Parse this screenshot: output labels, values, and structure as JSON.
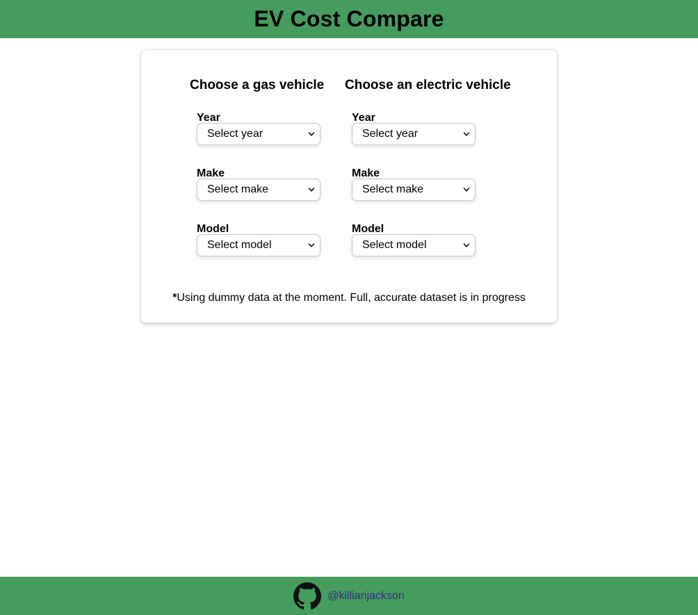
{
  "header": {
    "title": "EV Cost Compare"
  },
  "gas": {
    "title": "Choose a gas vehicle",
    "year_label": "Year",
    "year_value": "Select year",
    "make_label": "Make",
    "make_value": "Select make",
    "model_label": "Model",
    "model_value": "Select model"
  },
  "electric": {
    "title": "Choose an electric vehicle",
    "year_label": "Year",
    "year_value": "Select year",
    "make_label": "Make",
    "make_value": "Select make",
    "model_label": "Model",
    "model_value": "Select model"
  },
  "note": {
    "asterisk": "*",
    "text": "Using dummy data at the moment. Full, accurate dataset is in progress"
  },
  "footer": {
    "icon": "github-icon",
    "handle": "@killianjackson"
  },
  "colors": {
    "brand_green": "#459c5e",
    "link": "#3b2a86"
  }
}
